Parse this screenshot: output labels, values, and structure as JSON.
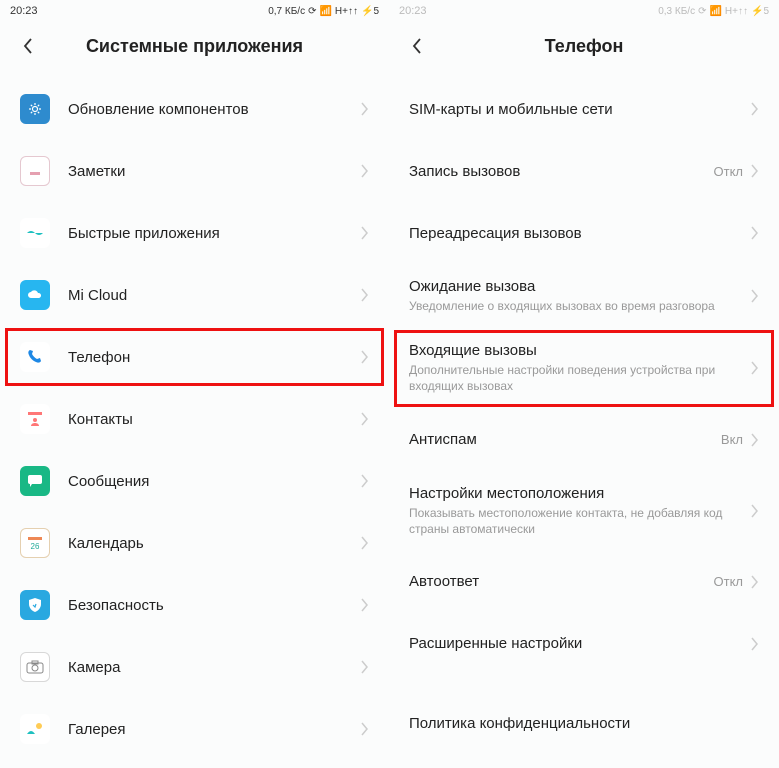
{
  "left": {
    "statusbar": {
      "time": "20:23",
      "speed": "0,7 КБ/с",
      "signal": "H+↑↑",
      "battery": "5"
    },
    "header": {
      "title": "Системные приложения"
    },
    "items": [
      {
        "label": "Обновление компонентов"
      },
      {
        "label": "Заметки"
      },
      {
        "label": "Быстрые приложения"
      },
      {
        "label": "Mi Cloud"
      },
      {
        "label": "Телефон",
        "highlighted": true
      },
      {
        "label": "Контакты"
      },
      {
        "label": "Сообщения"
      },
      {
        "label": "Календарь"
      },
      {
        "label": "Безопасность"
      },
      {
        "label": "Камера"
      },
      {
        "label": "Галерея"
      }
    ]
  },
  "right": {
    "statusbar": {
      "time": "20:23",
      "speed": "0,3 КБ/с",
      "signal": "H+↑↑",
      "battery": "5"
    },
    "header": {
      "title": "Телефон"
    },
    "items": [
      {
        "label": "SIM-карты и мобильные сети"
      },
      {
        "label": "Запись вызовов",
        "value": "Откл"
      },
      {
        "label": "Переадресация вызовов"
      },
      {
        "label": "Ожидание вызова",
        "sub": "Уведомление о входящих вызовах во время разговора"
      },
      {
        "label": "Входящие вызовы",
        "sub": "Дополнительные настройки поведения устройства при входящих вызовах",
        "highlighted": true
      },
      {
        "label": "Антиспам",
        "value": "Вкл"
      },
      {
        "label": "Настройки местоположения",
        "sub": "Показывать местоположение контакта, не добавляя код страны автоматически"
      },
      {
        "label": "Автоответ",
        "value": "Откл"
      },
      {
        "label": "Расширенные настройки"
      },
      {
        "label": "Политика конфиденциальности",
        "nochevron": true
      }
    ]
  }
}
